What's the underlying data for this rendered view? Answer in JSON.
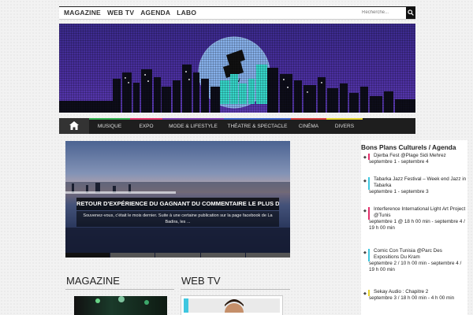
{
  "topnav": {
    "items": [
      "MAGAZINE",
      "WEB TV",
      "AGENDA",
      "LABO"
    ],
    "search_placeholder": "Recherche..."
  },
  "mainnav": {
    "home_icon": "home-icon",
    "items": [
      {
        "label": "MUSIQUE",
        "color": "#2fae4f"
      },
      {
        "label": "EXPO",
        "color": "#e2306b"
      },
      {
        "label": "MODE & LIFESTYLE",
        "color": "#7a3fb3"
      },
      {
        "label": "THÉATRE & SPECTACLE",
        "color": "#3f62c9"
      },
      {
        "label": "CINÉMA",
        "color": "#d63a3a"
      },
      {
        "label": "DIVERS",
        "color": "#e6d22b"
      }
    ]
  },
  "slider": {
    "title": "RETOUR D'EXPÉRIENCE DU GAGNANT DU COMMENTAIRE LE PLUS DRÔLE DE LA BADIRA",
    "excerpt": "Souvenez-vous, c'était le mois dernier. Suite à une certaine publication sur la page facebook de La Badira, les ..."
  },
  "sections": {
    "magazine": "MAGAZINE",
    "webtv": "WEB TV"
  },
  "sidebar": {
    "title": "Bons Plans Culturels / Agenda",
    "events": [
      {
        "name": "Djerba Fest @Plage Sidi Mehrez",
        "date": "septembre 1 - septembre 4",
        "color": "#e2306b"
      },
      {
        "name": "Tabarka Jazz Festival – Week end Jazz in Tabarka",
        "date": "septembre 1 - septembre 3",
        "color": "#3fc7e0"
      },
      {
        "name": "Interference International Light Art Project @Tunis",
        "date": "septembre 1 @ 18 h 00 min - septembre 4 / 19 h 00 min",
        "color": "#e2306b"
      },
      {
        "name": "Comic Con Tunisia @Parc Des Expositions Du Kram",
        "date": "septembre 2 / 10 h 00 min - septembre 4 / 19 h 00 min",
        "color": "#3fc7e0"
      },
      {
        "name": "Sekay Audio : Chapitre 2",
        "date": "septembre 3 / 18 h 00 min - 4 h 00 min",
        "color": "#e6d22b"
      }
    ]
  }
}
